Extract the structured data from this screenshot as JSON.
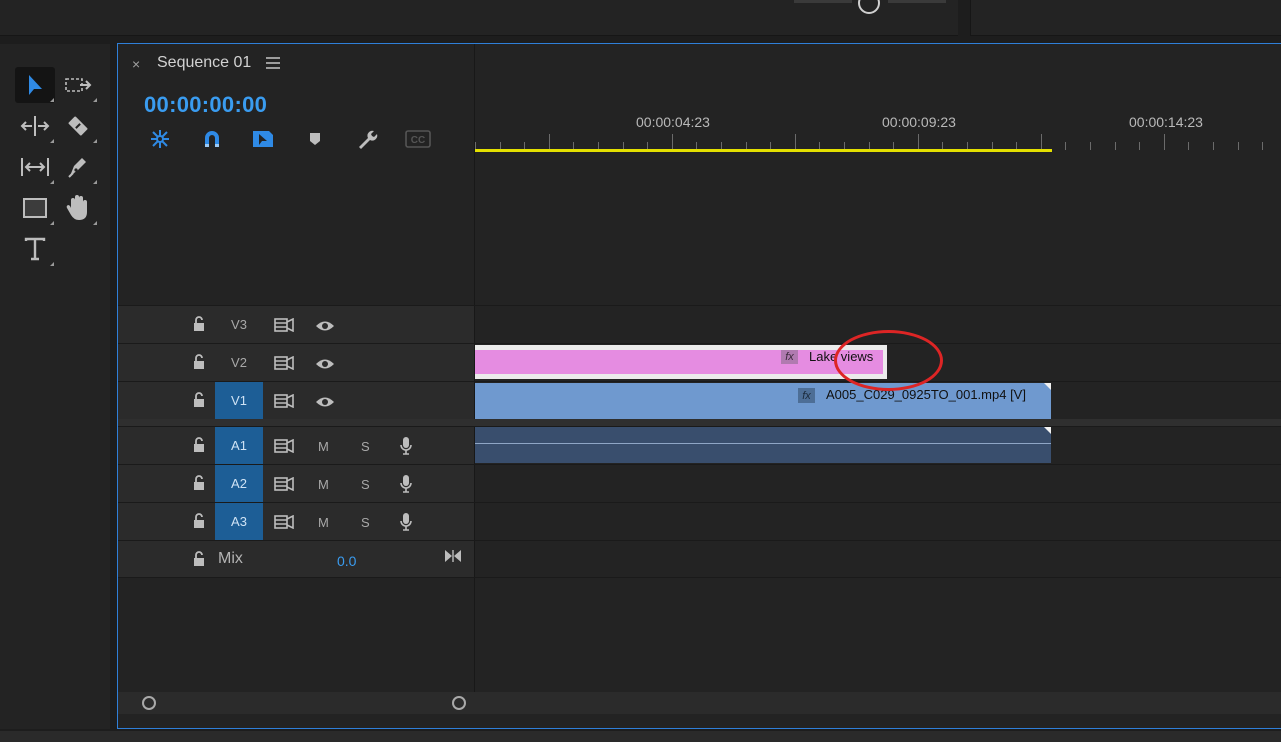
{
  "top": {
    "slider_state": "thumb"
  },
  "tools": [
    {
      "name": "selection-tool",
      "icon": "arrow-icon",
      "active": true
    },
    {
      "name": "track-select-tool",
      "icon": "track-select-icon",
      "active": false
    },
    {
      "name": "ripple-edit-tool",
      "icon": "ripple-edit-icon",
      "active": false
    },
    {
      "name": "razor-tool",
      "icon": "razor-icon",
      "active": false
    },
    {
      "name": "slip-tool",
      "icon": "slip-icon",
      "active": false
    },
    {
      "name": "pen-tool",
      "icon": "pen-icon",
      "active": false
    },
    {
      "name": "rectangle-tool",
      "icon": "rectangle-icon",
      "active": false
    },
    {
      "name": "hand-tool",
      "icon": "hand-icon",
      "active": false
    },
    {
      "name": "type-tool",
      "icon": "type-icon",
      "active": false
    }
  ],
  "panel": {
    "close": "×",
    "title": "Sequence 01",
    "timecode": "00:00:00:00"
  },
  "timeline_tools": [
    "nest-icon",
    "snap-magnet-icon",
    "linked-selection-icon",
    "add-marker-icon",
    "wrench-settings-icon",
    "captions-icon"
  ],
  "ruler": {
    "labels": [
      "00:00:04:23",
      "00:00:09:23",
      "00:00:14:23"
    ],
    "work_area_color": "#e4e000"
  },
  "tracks": {
    "video": [
      {
        "label": "V3",
        "targeted": false
      },
      {
        "label": "V2",
        "targeted": false
      },
      {
        "label": "V1",
        "targeted": true
      }
    ],
    "audio": [
      {
        "label": "A1",
        "m": "M",
        "s": "S"
      },
      {
        "label": "A2",
        "m": "M",
        "s": "S"
      },
      {
        "label": "A3",
        "m": "M",
        "s": "S"
      }
    ],
    "mix": {
      "label": "Mix",
      "value": "0.0"
    }
  },
  "clips": {
    "title_clip": {
      "fx": "fx",
      "name": "Lake views",
      "color": "#e58ce1"
    },
    "video_clip": {
      "fx": "fx",
      "name": "A005_C029_0925TO_001.mp4 [V]",
      "color": "#6f99cf"
    },
    "audio_clip": {
      "color": "#394e6d"
    }
  },
  "annotation": {
    "shape": "red-ellipse",
    "color": "#dd2525"
  },
  "accent_color": "#3a9cf0"
}
